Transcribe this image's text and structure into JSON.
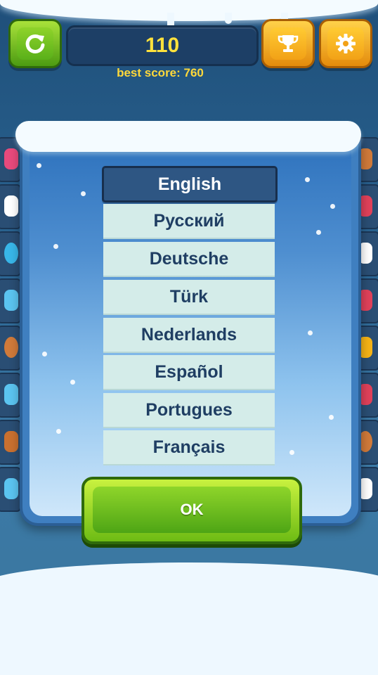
{
  "score": "110",
  "best_score_label": "best score: 760",
  "buttons": {
    "restart_icon": "restart-icon",
    "trophy_icon": "trophy-icon",
    "settings_icon": "gear-icon",
    "ok_label": "OK"
  },
  "languages": [
    "English",
    "Русский",
    "Deutsche",
    "Türk",
    "Nederlands",
    "Español",
    "Portugues",
    "Français"
  ],
  "selected_language": "English",
  "colors": {
    "score_text": "#ffe23c",
    "selected_bg": "#2e5683",
    "option_bg": "#d4ece9",
    "ok_green": "#6dbb14"
  }
}
